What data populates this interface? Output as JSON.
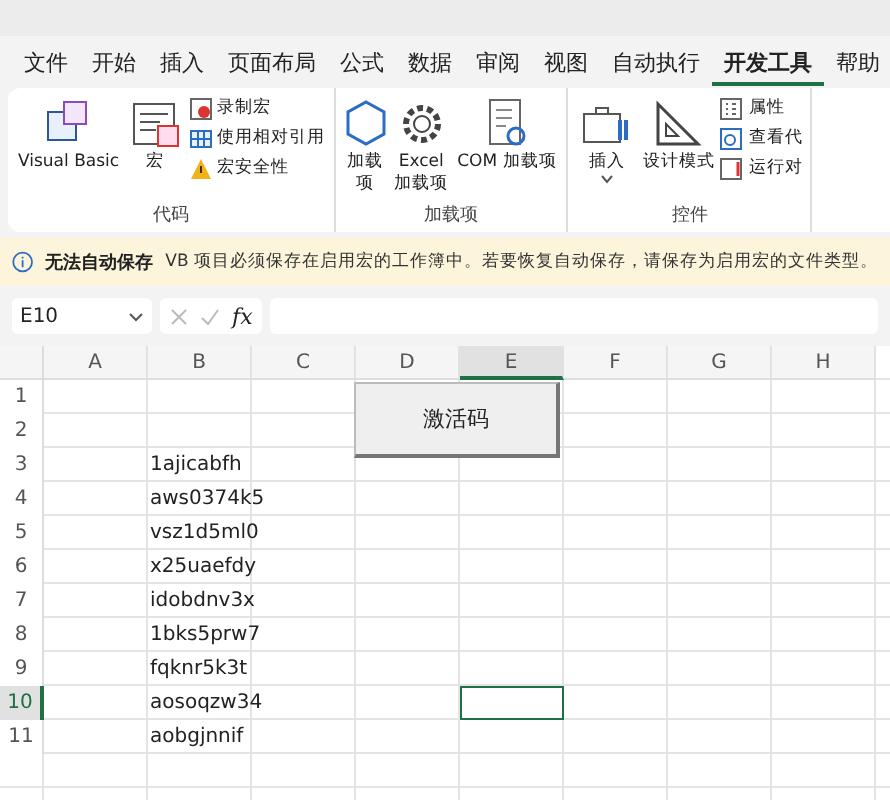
{
  "menu_tabs": [
    {
      "label": "文件",
      "selected": false
    },
    {
      "label": "开始",
      "selected": false
    },
    {
      "label": "插入",
      "selected": false
    },
    {
      "label": "页面布局",
      "selected": false
    },
    {
      "label": "公式",
      "selected": false
    },
    {
      "label": "数据",
      "selected": false
    },
    {
      "label": "审阅",
      "selected": false
    },
    {
      "label": "视图",
      "selected": false
    },
    {
      "label": "自动执行",
      "selected": false
    },
    {
      "label": "开发工具",
      "selected": true
    },
    {
      "label": "帮助",
      "selected": false
    }
  ],
  "ribbon_groups": [
    {
      "label": "代码",
      "items": [
        {
          "kind": "large",
          "label": "Visual Basic"
        },
        {
          "kind": "large",
          "label": "宏"
        },
        {
          "kind": "stack",
          "entries": [
            {
              "label": "录制宏"
            },
            {
              "label": "使用相对引用"
            },
            {
              "label": "宏安全性"
            }
          ]
        }
      ]
    },
    {
      "label": "加载项",
      "items": [
        {
          "kind": "large",
          "label": "加载项"
        },
        {
          "kind": "large",
          "label": "Excel\n加载项"
        },
        {
          "kind": "large",
          "label": "COM 加载项"
        }
      ]
    },
    {
      "label": "控件",
      "items": [
        {
          "kind": "large",
          "label": "插入",
          "dropdown": true
        },
        {
          "kind": "large",
          "label": "设计模式"
        },
        {
          "kind": "stack",
          "entries": [
            {
              "label": "属性"
            },
            {
              "label": "查看代"
            },
            {
              "label": "运行对"
            }
          ]
        }
      ]
    }
  ],
  "info_bar": {
    "title": "无法自动保存",
    "message": "VB 项目必须保存在启用宏的工作簿中。若要恢复自动保存，请保存为启用宏的文件类型。"
  },
  "formula_bar": {
    "name_box": "E10",
    "fx": "fx"
  },
  "columns": [
    {
      "label": "A",
      "selected": false
    },
    {
      "label": "B",
      "selected": false
    },
    {
      "label": "C",
      "selected": false
    },
    {
      "label": "D",
      "selected": false
    },
    {
      "label": "E",
      "selected": true
    },
    {
      "label": "F",
      "selected": false
    },
    {
      "label": "G",
      "selected": false
    },
    {
      "label": "H",
      "selected": false
    }
  ],
  "rows": [
    {
      "number": "1",
      "selected": false,
      "b": ""
    },
    {
      "number": "2",
      "selected": false,
      "b": ""
    },
    {
      "number": "3",
      "selected": false,
      "b": "1ajicabfh"
    },
    {
      "number": "4",
      "selected": false,
      "b": "aws0374k5"
    },
    {
      "number": "5",
      "selected": false,
      "b": "vsz1d5ml0"
    },
    {
      "number": "6",
      "selected": false,
      "b": "x25uaefdy"
    },
    {
      "number": "7",
      "selected": false,
      "b": "idobdnv3x"
    },
    {
      "number": "8",
      "selected": false,
      "b": "1bks5prw7"
    },
    {
      "number": "9",
      "selected": false,
      "b": "fqknr5k3t"
    },
    {
      "number": "10",
      "selected": true,
      "b": "aosoqzw34"
    },
    {
      "number": "11",
      "selected": false,
      "b": "aobgjnnif"
    }
  ],
  "sheet_button": {
    "label": "激活码"
  }
}
